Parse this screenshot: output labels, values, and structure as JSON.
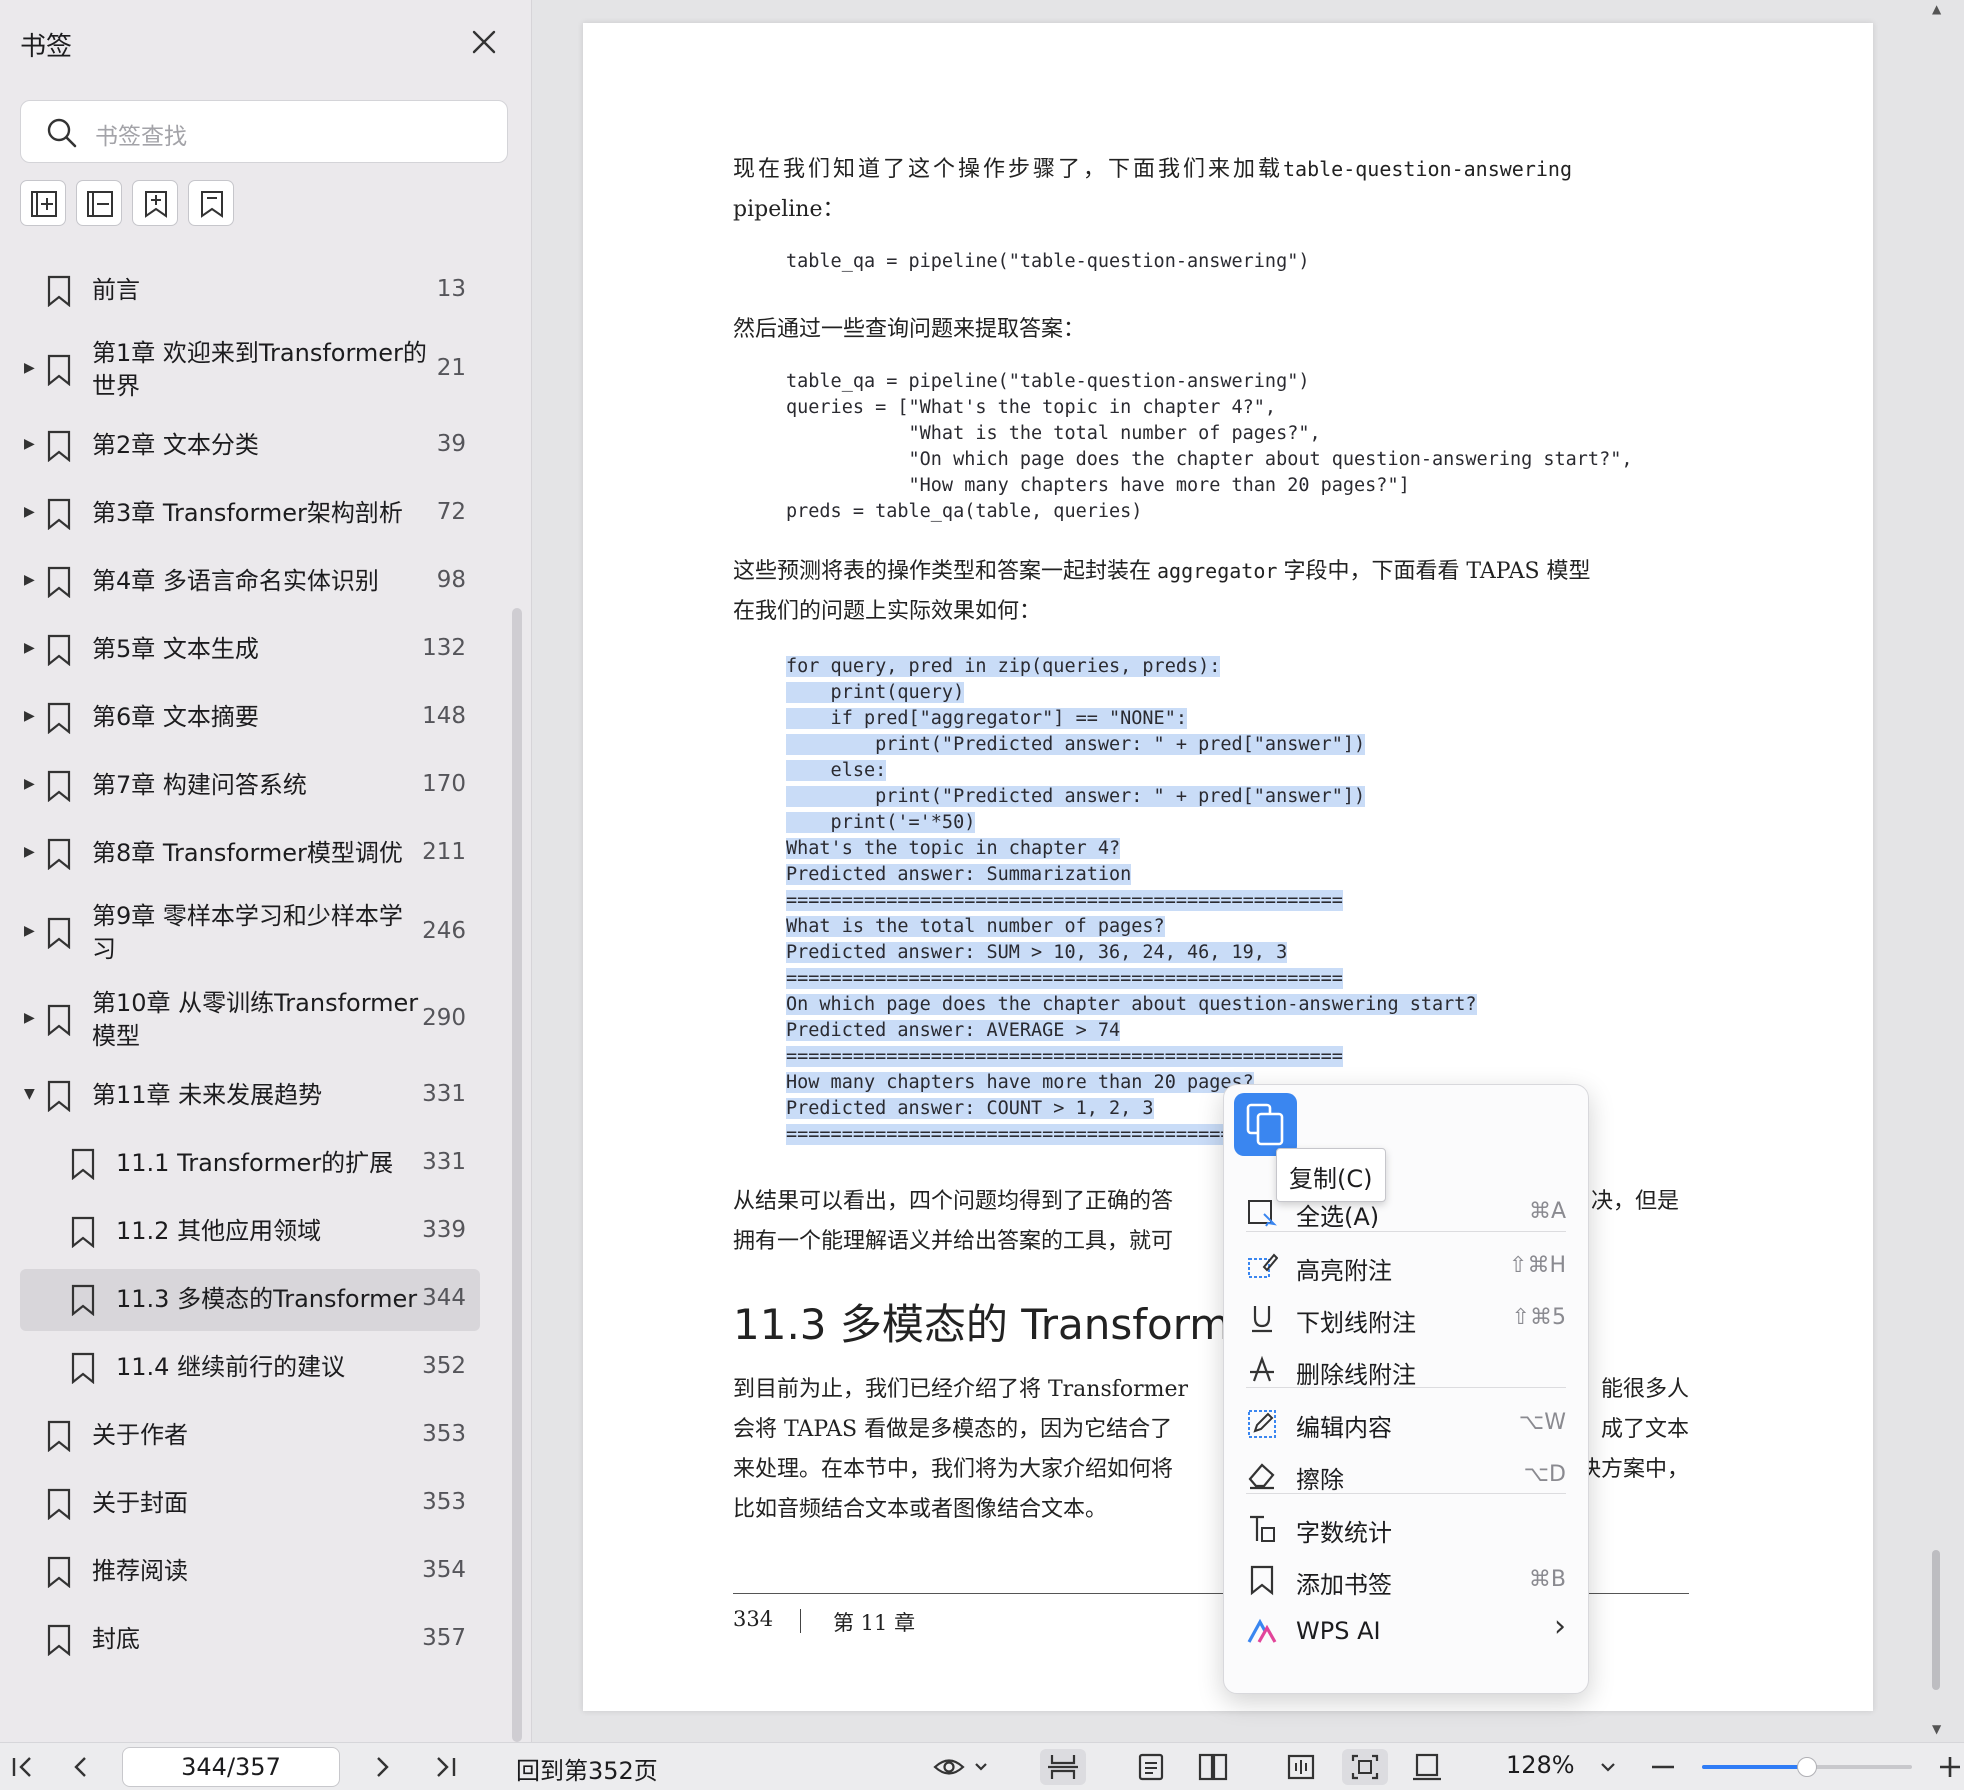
{
  "sidebar": {
    "title": "书签",
    "search_placeholder": "书签查找",
    "bookmarks": [
      {
        "label": "前言",
        "page": "13",
        "level": 0,
        "expand": "none"
      },
      {
        "label": "第1章 欢迎来到Transformer的世界",
        "label_l1": "第1章 欢迎来到Transformer的",
        "label_l2": "世界",
        "page": "21",
        "level": 0,
        "expand": "collapsed"
      },
      {
        "label": "第2章 文本分类",
        "page": "39",
        "level": 0,
        "expand": "collapsed"
      },
      {
        "label": "第3章 Transformer架构剖析",
        "page": "72",
        "level": 0,
        "expand": "collapsed"
      },
      {
        "label": "第4章 多语言命名实体识别",
        "page": "98",
        "level": 0,
        "expand": "collapsed"
      },
      {
        "label": "第5章 文本生成",
        "page": "132",
        "level": 0,
        "expand": "collapsed"
      },
      {
        "label": "第6章 文本摘要",
        "page": "148",
        "level": 0,
        "expand": "collapsed"
      },
      {
        "label": "第7章 构建问答系统",
        "page": "170",
        "level": 0,
        "expand": "collapsed"
      },
      {
        "label": "第8章 Transformer模型调优",
        "page": "211",
        "level": 0,
        "expand": "collapsed"
      },
      {
        "label": "第9章 零样本学习和少样本学习",
        "label_l1": "第9章 零样本学习和少样本学",
        "label_l2": "习",
        "page": "246",
        "level": 0,
        "expand": "collapsed"
      },
      {
        "label": "第10章 从零训练Transformer模型",
        "label_l1": "第10章 从零训练Transformer",
        "label_l2": "模型",
        "page": "290",
        "level": 0,
        "expand": "collapsed"
      },
      {
        "label": "第11章 未来发展趋势",
        "page": "331",
        "level": 0,
        "expand": "expanded"
      },
      {
        "label": "11.1 Transformer的扩展",
        "page": "331",
        "level": 1,
        "expand": "none"
      },
      {
        "label": "11.2 其他应用领域",
        "page": "339",
        "level": 1,
        "expand": "none"
      },
      {
        "label": "11.3 多模态的Transformer",
        "page": "344",
        "level": 1,
        "expand": "none",
        "active": true
      },
      {
        "label": "11.4 继续前行的建议",
        "page": "352",
        "level": 1,
        "expand": "none"
      },
      {
        "label": "关于作者",
        "page": "353",
        "level": 0,
        "expand": "none"
      },
      {
        "label": "关于封面",
        "page": "353",
        "level": 0,
        "expand": "none"
      },
      {
        "label": "推荐阅读",
        "page": "354",
        "level": 0,
        "expand": "none"
      },
      {
        "label": "封底",
        "page": "357",
        "level": 0,
        "expand": "none"
      }
    ]
  },
  "document": {
    "para1_a": "现在我们知道了这个操作步骤了，下面我们来加载",
    "para1_code": "table-question-answering",
    "para1_b": "pipeline：",
    "code1": "table_qa = pipeline(\"table-question-answering\")",
    "para2": "然后通过一些查询问题来提取答案：",
    "code2": [
      "table_qa = pipeline(\"table-question-answering\")",
      "queries = [\"What's the topic in chapter 4?\",",
      "           \"What is the total number of pages?\",",
      "           \"On which page does the chapter about question-answering start?\",",
      "           \"How many chapters have more than 20 pages?\"]",
      "preds = table_qa(table, queries)"
    ],
    "para3_a": "这些预测将表的操作类型和答案一起封装在",
    "para3_code": "aggregator",
    "para3_b": "字段中，下面看看 TAPAS 模型",
    "para3_c": "在我们的问题上实际效果如何：",
    "code3": [
      "for query, pred in zip(queries, preds):",
      "    print(query)",
      "    if pred[\"aggregator\"] == \"NONE\":",
      "        print(\"Predicted answer: \" + pred[\"answer\"])",
      "    else:",
      "        print(\"Predicted answer: \" + pred[\"answer\"])",
      "    print('='*50)",
      "What's the topic in chapter 4?",
      "Predicted answer: Summarization",
      "==================================================",
      "What is the total number of pages?",
      "Predicted answer: SUM > 10, 36, 24, 46, 19, 3",
      "==================================================",
      "On which page does the chapter about question-answering start?",
      "Predicted answer: AVERAGE > 74",
      "==================================================",
      "How many chapters have more than 20 pages?",
      "Predicted answer: COUNT > 1, 2, 3",
      "=================================================="
    ],
    "para4_l1a": "从结果可以看出，四个问题均得到了正确的答",
    "para4_l1b": "决，但是",
    "para4_l2": "拥有一个能理解语义并给出答案的工具，就可",
    "heading": "11.3 多模态的 Transform",
    "para5": [
      {
        "a": "到目前为止，我们已经介绍了将 Transformer",
        "b": "能很多人"
      },
      {
        "a": "会将 TAPAS 看做是多模态的，因为它结合了",
        "b": "成了文本"
      },
      {
        "a": "来处理。在本节中，我们将为大家介绍如何将",
        "b": "决方案中，"
      },
      {
        "a": "比如音频结合文本或者图像结合文本。",
        "b": ""
      }
    ],
    "footer_page": "334",
    "footer_chapter": "第 11 章"
  },
  "context_menu": {
    "tooltip": "复制(C)",
    "items": [
      {
        "label": "全选(A)",
        "shortcut": "⌘A",
        "icon": "select-all-icon"
      },
      {
        "label": "高亮附注",
        "shortcut": "⇧⌘H",
        "icon": "highlight-icon"
      },
      {
        "label": "下划线附注",
        "shortcut": "⇧⌘5",
        "icon": "underline-icon"
      },
      {
        "label": "删除线附注",
        "shortcut": "",
        "icon": "strikethrough-icon"
      },
      {
        "label": "编辑内容",
        "shortcut": "⌥W",
        "icon": "edit-icon"
      },
      {
        "label": "擦除",
        "shortcut": "⌥D",
        "icon": "eraser-icon"
      },
      {
        "label": "字数统计",
        "shortcut": "",
        "icon": "word-count-icon"
      },
      {
        "label": "添加书签",
        "shortcut": "⌘B",
        "icon": "bookmark-icon"
      },
      {
        "label": "WPS AI",
        "shortcut": "›",
        "icon": "wps-ai-icon"
      }
    ]
  },
  "bottombar": {
    "page_indicator": "344/357",
    "back_to": "回到第352页",
    "zoom": "128%",
    "zoom_fraction": 0.5
  },
  "colors": {
    "accent": "#2f7cf6",
    "selection": "#c9dcf7",
    "copy_button": "#3a86f0"
  }
}
